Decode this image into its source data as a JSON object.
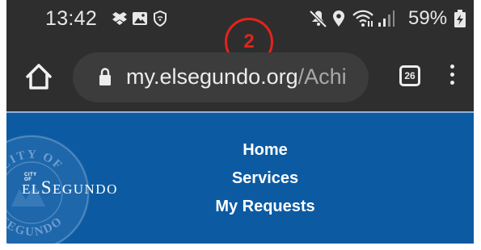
{
  "status_bar": {
    "time": "13:42",
    "battery_percent": "59%",
    "left_icons": [
      "dropbox-icon",
      "gallery-icon",
      "vpn-shield-icon"
    ],
    "right_icons": [
      "mute-icon",
      "location-icon",
      "wifi-icon",
      "signal-icon",
      "battery-charging-icon"
    ]
  },
  "annotation": {
    "number": "2",
    "color": "#e5231b"
  },
  "browser": {
    "url_host": "my.elsegundo.org",
    "url_path": "/Achi",
    "tab_count": "26",
    "icons": [
      "home-icon",
      "lock-icon",
      "tab-switcher-icon",
      "more-vert-icon"
    ]
  },
  "site": {
    "header_color": "#0c5aa2",
    "logo": {
      "small": "CITY OF",
      "main_prefix": "EL",
      "main_cap": "S",
      "main_rest": "EGUNDO"
    },
    "seal_text": [
      "CITY OF",
      "SEGUNDO"
    ],
    "nav": [
      "Home",
      "Services",
      "My Requests"
    ]
  }
}
